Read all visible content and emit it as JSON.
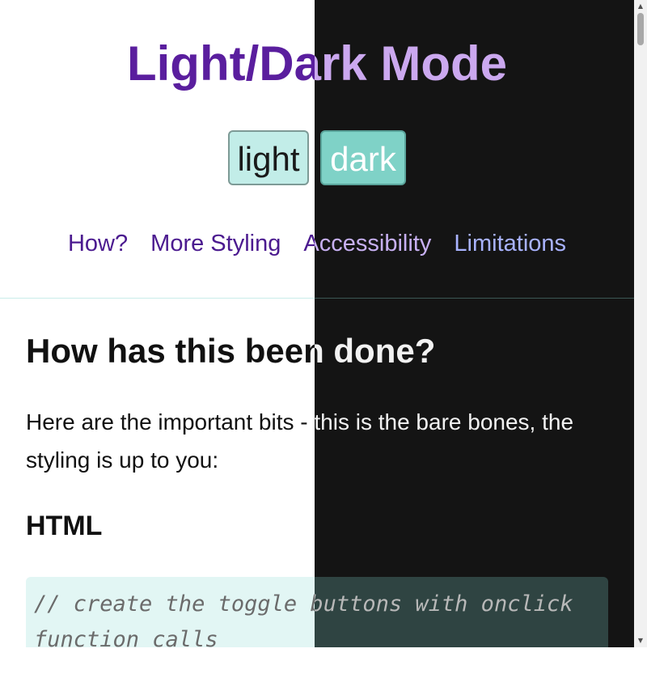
{
  "page": {
    "title": "Light/Dark Mode",
    "toggles": {
      "light_label": "light",
      "dark_label": "dark"
    },
    "nav": [
      "How?",
      "More Styling",
      "Accessibility",
      "Limitations"
    ],
    "section": {
      "heading": "How has this been done?",
      "paragraph": "Here are the important bits - this is the bare bones, the styling is up to you:",
      "subheading": "HTML",
      "code": "// create the toggle buttons with onclick function calls"
    }
  },
  "colors": {
    "light_bg": "#ffffff",
    "dark_bg": "#141414",
    "light_title": "#5a1e9e",
    "dark_title": "#cba8ef",
    "button_light": "#c2ede8",
    "button_dark": "#7fd2c7"
  },
  "scrollbar": {
    "up_icon": "chevron-up-icon",
    "down_icon": "chevron-down-icon"
  }
}
